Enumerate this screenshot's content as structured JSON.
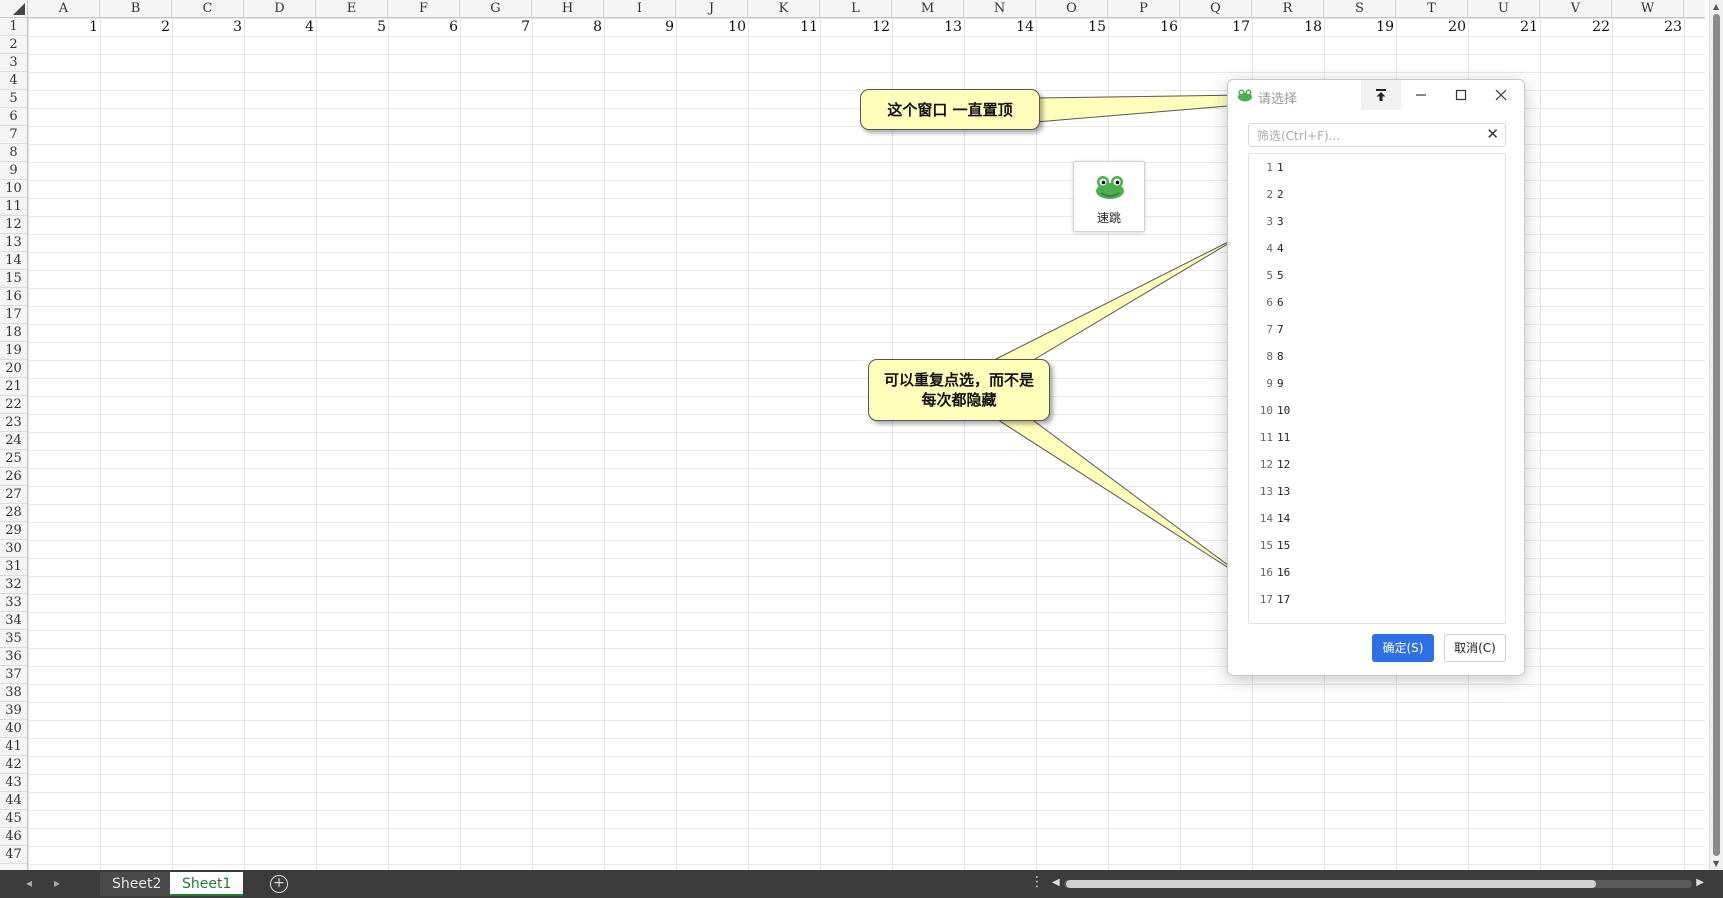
{
  "sheet": {
    "columns": [
      "A",
      "B",
      "C",
      "D",
      "E",
      "F",
      "G",
      "H",
      "I",
      "J",
      "K",
      "L",
      "M",
      "N",
      "O",
      "P",
      "Q",
      "R",
      "S",
      "T",
      "U",
      "V",
      "W"
    ],
    "rows": [
      "1",
      "2",
      "3",
      "4",
      "5",
      "6",
      "7",
      "8",
      "9",
      "10",
      "11",
      "12",
      "13",
      "14",
      "15",
      "16",
      "17",
      "18",
      "19",
      "20",
      "21",
      "22",
      "23",
      "24",
      "25",
      "26",
      "27",
      "28",
      "29",
      "30",
      "31",
      "32",
      "33",
      "34",
      "35",
      "36",
      "37",
      "38",
      "39",
      "40",
      "41",
      "42",
      "43",
      "44",
      "45",
      "46",
      "47"
    ],
    "row1_values": [
      "1",
      "2",
      "3",
      "4",
      "5",
      "6",
      "7",
      "8",
      "9",
      "10",
      "11",
      "12",
      "13",
      "14",
      "15",
      "16",
      "17",
      "18",
      "19",
      "20",
      "21",
      "22",
      "23"
    ]
  },
  "tabs": {
    "sheet2": "Sheet2",
    "sheet1": "Sheet1",
    "add_icon": "plus-circle-icon"
  },
  "callouts": {
    "pin_note": "这个窗口 一直置顶",
    "select_note": "可以重复点选，而不是每次都隐藏"
  },
  "jump_widget": {
    "label": "速跳",
    "icon": "frog-icon"
  },
  "dialog": {
    "title": "请选择",
    "filter_placeholder": "筛选(Ctrl+F)...",
    "filter_value": "",
    "items": [
      {
        "idx": "1",
        "label": "1"
      },
      {
        "idx": "2",
        "label": "2"
      },
      {
        "idx": "3",
        "label": "3"
      },
      {
        "idx": "4",
        "label": "4"
      },
      {
        "idx": "5",
        "label": "5"
      },
      {
        "idx": "6",
        "label": "6"
      },
      {
        "idx": "7",
        "label": "7"
      },
      {
        "idx": "8",
        "label": "8"
      },
      {
        "idx": "9",
        "label": "9"
      },
      {
        "idx": "10",
        "label": "10"
      },
      {
        "idx": "11",
        "label": "11"
      },
      {
        "idx": "12",
        "label": "12"
      },
      {
        "idx": "13",
        "label": "13"
      },
      {
        "idx": "14",
        "label": "14"
      },
      {
        "idx": "15",
        "label": "15"
      },
      {
        "idx": "16",
        "label": "16"
      },
      {
        "idx": "17",
        "label": "17"
      }
    ],
    "ok_label": "确定(S)",
    "cancel_label": "取消(C)",
    "accent": "#2f6fe8"
  }
}
